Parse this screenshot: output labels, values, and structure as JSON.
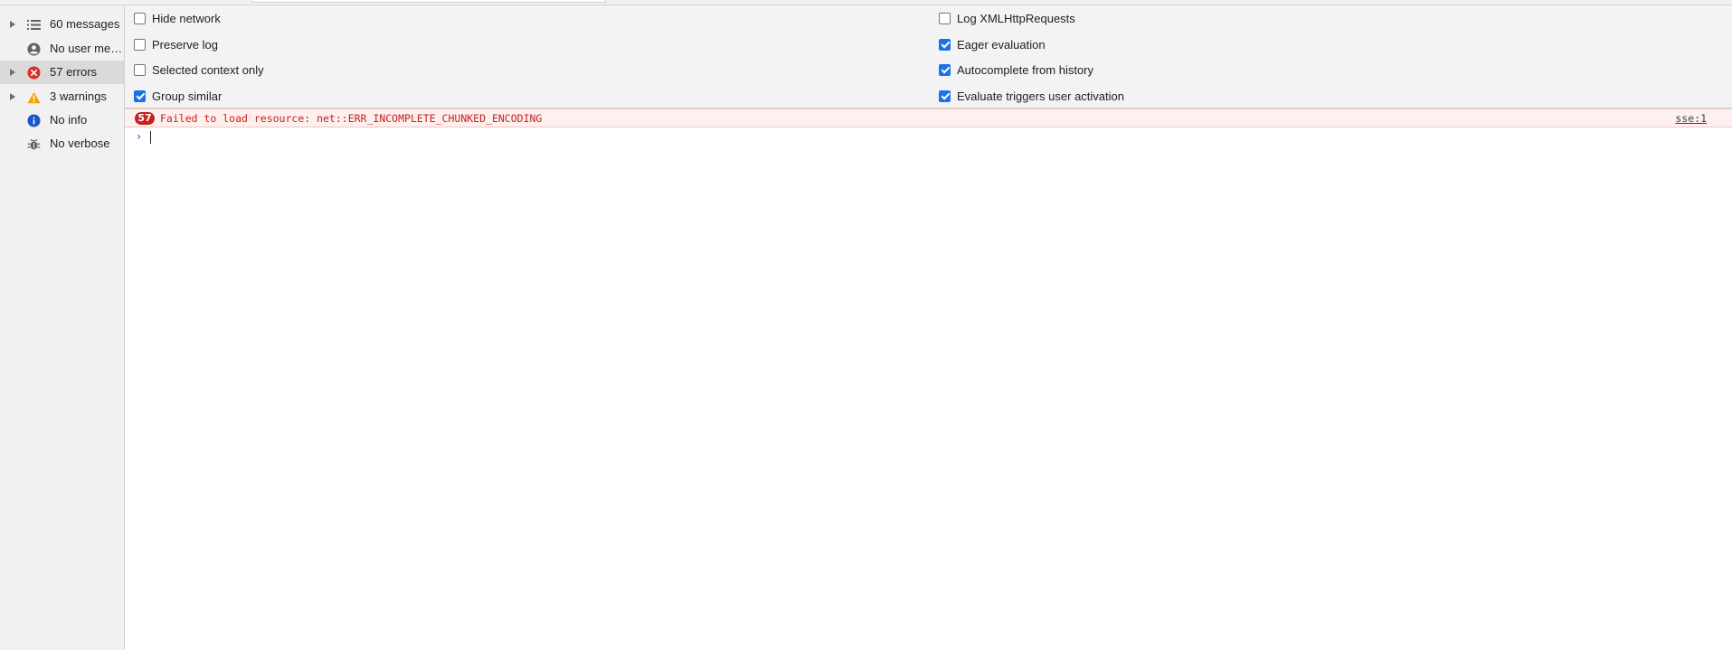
{
  "sidebar": {
    "items": [
      {
        "label": "60 messages",
        "icon": "list-icon",
        "expandable": true,
        "selected": false
      },
      {
        "label": "No user me…",
        "icon": "user-icon",
        "expandable": false,
        "selected": false
      },
      {
        "label": "57 errors",
        "icon": "error-icon",
        "expandable": true,
        "selected": true
      },
      {
        "label": "3 warnings",
        "icon": "warning-icon",
        "expandable": true,
        "selected": false
      },
      {
        "label": "No info",
        "icon": "info-icon",
        "expandable": false,
        "selected": false
      },
      {
        "label": "No verbose",
        "icon": "bug-icon",
        "expandable": false,
        "selected": false
      }
    ]
  },
  "settings": {
    "left": [
      {
        "label": "Hide network",
        "checked": false
      },
      {
        "label": "Preserve log",
        "checked": false
      },
      {
        "label": "Selected context only",
        "checked": false
      },
      {
        "label": "Group similar",
        "checked": true
      }
    ],
    "right": [
      {
        "label": "Log XMLHttpRequests",
        "checked": false
      },
      {
        "label": "Eager evaluation",
        "checked": true
      },
      {
        "label": "Autocomplete from history",
        "checked": true
      },
      {
        "label": "Evaluate triggers user activation",
        "checked": true
      }
    ]
  },
  "console": {
    "error": {
      "count": "57",
      "message": "Failed to load resource: net::ERR_INCOMPLETE_CHUNKED_ENCODING",
      "source": "sse:1"
    },
    "prompt_symbol": "›"
  },
  "colors": {
    "error": "#c5221f",
    "error_bg": "#fdf0ef",
    "accent": "#1a73e8",
    "warning": "#f2a600",
    "info": "#1a56c7"
  }
}
